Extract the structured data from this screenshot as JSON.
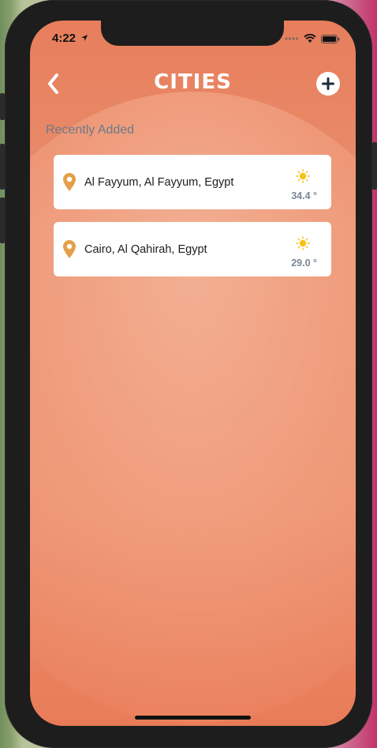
{
  "status_bar": {
    "time": "4:22",
    "location_icon": "location-arrow-icon",
    "signal_icon": "signal-icon",
    "wifi_icon": "wifi-icon",
    "battery_icon": "battery-icon"
  },
  "header": {
    "title": "CITIES",
    "back_icon": "chevron-left-icon",
    "add_icon": "plus-icon"
  },
  "section": {
    "label": "Recently Added"
  },
  "cities": [
    {
      "name": "Al Fayyum, Al Fayyum, Egypt",
      "temperature": "34.4 °",
      "weather_icon": "sun-icon"
    },
    {
      "name": "Cairo, Al Qahirah, Egypt",
      "temperature": "29.0 °",
      "weather_icon": "sun-icon"
    }
  ],
  "colors": {
    "accent": "#e9906f",
    "pin": "#e3a04a",
    "sun": "#f6c21c",
    "muted_text": "#7a8797"
  }
}
